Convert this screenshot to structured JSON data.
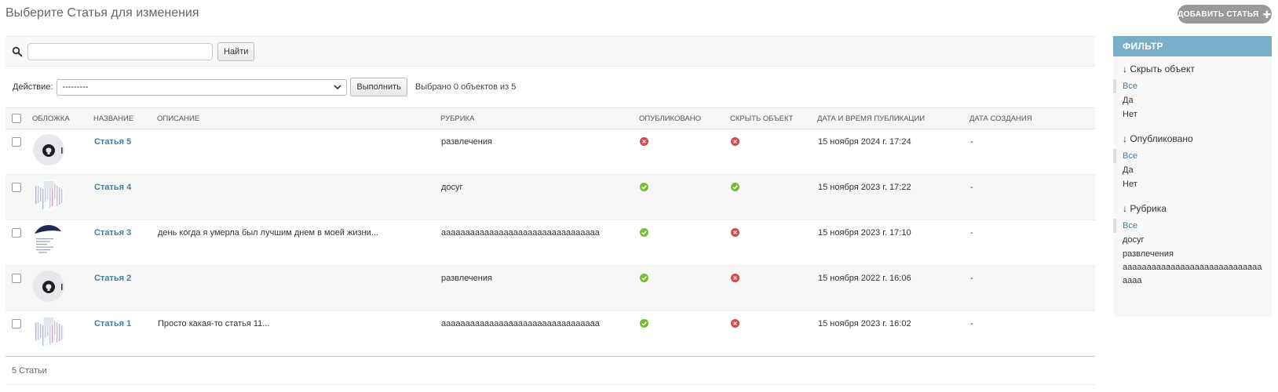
{
  "title": "Выберите Статья для изменения",
  "add_button": "ДОБАВИТЬ СТАТЬЯ",
  "search": {
    "placeholder": "",
    "button": "Найти"
  },
  "actions": {
    "label": "Действие:",
    "selected": "---------",
    "run_button": "Выполнить",
    "counter": "Выбрано 0 объектов из 5"
  },
  "table": {
    "headers": {
      "cover": "ОБЛОЖКА",
      "name": "НАЗВАНИЕ",
      "description": "ОПИСАНИЕ",
      "category": "РУБРИКА",
      "published": "ОПУБЛИКОВАНО",
      "hidden": "СКРЫТЬ ОБЪЕКТ",
      "pub_datetime": "ДАТА И ВРЕМЯ ПУБЛИКАЦИИ",
      "created": "ДАТА СОЗДАНИЯ"
    },
    "rows": [
      {
        "name": "Статья 5",
        "description": "",
        "category": "развлечения",
        "published": false,
        "hidden": false,
        "pub_datetime": "15 ноября 2024 г. 17:24",
        "created": "-",
        "cover": "github"
      },
      {
        "name": "Статья 4",
        "description": "",
        "category": "досуг",
        "published": true,
        "hidden": true,
        "pub_datetime": "15 ноября 2023 г. 17:22",
        "created": "-",
        "cover": "charts"
      },
      {
        "name": "Статья 3",
        "description": "день когда я умерла был лучшим днем в моей жизни...",
        "category": "ааааааааааааааааааааааааааааааааа",
        "published": true,
        "hidden": false,
        "pub_datetime": "15 ноября 2023 г. 17:10",
        "created": "-",
        "cover": "document"
      },
      {
        "name": "Статья 2",
        "description": "",
        "category": "развлечения",
        "published": true,
        "hidden": false,
        "pub_datetime": "15 ноября 2022 г. 16:06",
        "created": "-",
        "cover": "github"
      },
      {
        "name": "Статья 1",
        "description": "Просто какая-то статья 11...",
        "category": "ааааааааааааааааааааааааааааааааа",
        "published": true,
        "hidden": false,
        "pub_datetime": "15 ноября 2023 г. 16:02",
        "created": "-",
        "cover": "charts"
      }
    ]
  },
  "paginator": "5 Статьи",
  "filter": {
    "title": "ФИЛЬТР",
    "groups": [
      {
        "title": "↓ Скрыть объект",
        "options": [
          "Все",
          "Да",
          "Нет"
        ]
      },
      {
        "title": "↓ Опубликовано",
        "options": [
          "Все",
          "Да",
          "Нет"
        ]
      },
      {
        "title": "↓ Рубрика",
        "options": [
          "Все",
          "досуг",
          "развлечения",
          "ааааааааааааааааааааааааааааааааа"
        ]
      }
    ]
  },
  "colors": {
    "link": "#447e9b",
    "filter_head": "#79aec8",
    "yes": "#70bf2b",
    "no": "#dd4646"
  }
}
